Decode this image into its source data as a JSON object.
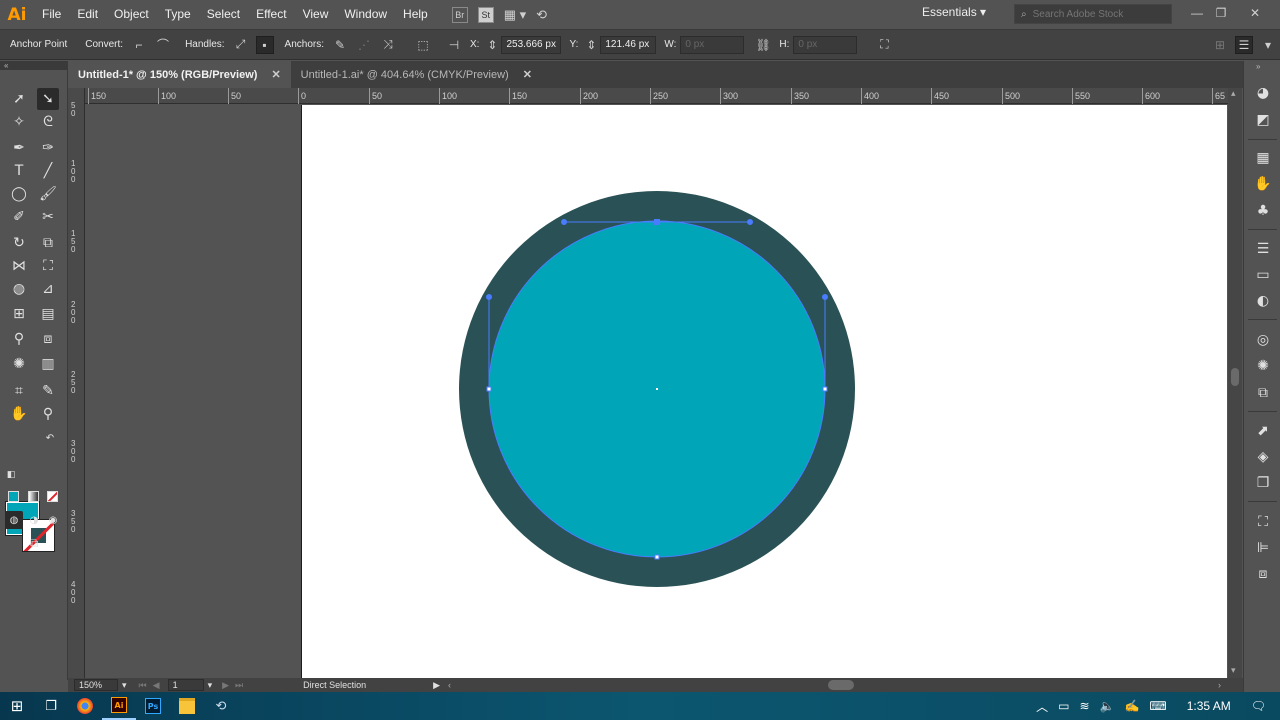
{
  "app": {
    "logo": "Ai"
  },
  "menu": {
    "items": [
      "File",
      "Edit",
      "Object",
      "Type",
      "Select",
      "Effect",
      "View",
      "Window",
      "Help"
    ]
  },
  "menu_icons": {
    "bridge": "Br",
    "stock": "St"
  },
  "workspace": {
    "label": "Essentials"
  },
  "search": {
    "placeholder": "Search Adobe Stock"
  },
  "controlbar": {
    "anchor_point_label": "Anchor Point",
    "convert_label": "Convert:",
    "handles_label": "Handles:",
    "anchors_label": "Anchors:",
    "x_label": "X:",
    "x_value": "253.666 px",
    "y_label": "Y:",
    "y_value": "121.46 px",
    "w_label": "W:",
    "w_value": "0 px",
    "h_label": "H:",
    "h_value": "0 px"
  },
  "tabs": [
    {
      "label": "Untitled-1* @ 150% (RGB/Preview)",
      "active": true
    },
    {
      "label": "Untitled-1.ai* @ 404.64% (CMYK/Preview)",
      "active": false
    }
  ],
  "ruler": {
    "horizontal_ticks": [
      "150",
      "100",
      "50",
      "0",
      "50",
      "100",
      "150",
      "200",
      "250",
      "300",
      "350",
      "400",
      "450",
      "500",
      "550",
      "600",
      "65"
    ],
    "vertical_ticks": [
      "50",
      "100",
      "150",
      "200",
      "250",
      "300",
      "350",
      "400"
    ]
  },
  "statusbar": {
    "zoom": "150%",
    "artboard_number": "1",
    "current_tool": "Direct Selection"
  },
  "colors": {
    "fill": "#00a6b8",
    "stroke": "#2a5256",
    "outer_circle": "#2a5256",
    "inner_circle": "#00a6b8",
    "selection": "#4a7cff"
  },
  "taskbar": {
    "time": "1:35 AM",
    "apps": [
      "chrome",
      "Ai",
      "Ps",
      "file-explorer",
      "edge"
    ]
  }
}
